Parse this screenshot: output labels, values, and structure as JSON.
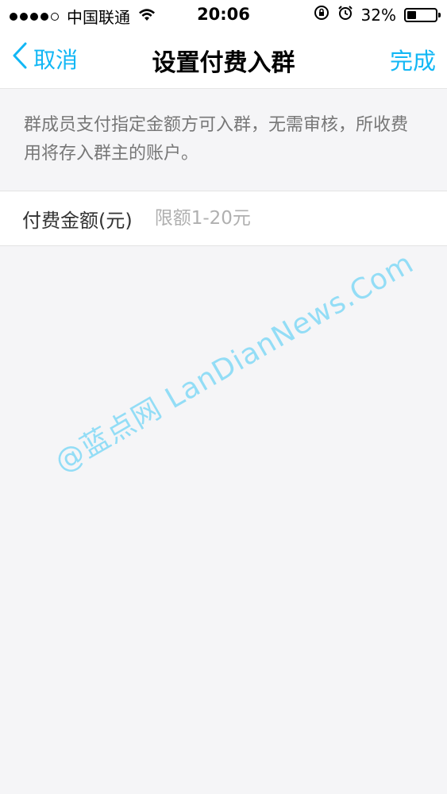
{
  "status_bar": {
    "carrier": "中国联通",
    "time": "20:06",
    "battery_percent": "32%",
    "battery_level": 0.32
  },
  "nav": {
    "back_label": "取消",
    "title": "设置付费入群",
    "done_label": "完成"
  },
  "description": "群成员支付指定金额方可入群，无需审核，所收费用将存入群主的账户。",
  "amount_field": {
    "label": "付费金额(元)",
    "placeholder": "限额1-20元",
    "value": ""
  },
  "watermark": "@蓝点网 LanDianNews.Com",
  "colors": {
    "accent": "#12b7f5",
    "background": "#f5f5f7"
  },
  "icons": [
    "signal-dots-icon",
    "wifi-icon",
    "rotation-lock-icon",
    "alarm-icon",
    "battery-icon",
    "chevron-left-icon"
  ]
}
